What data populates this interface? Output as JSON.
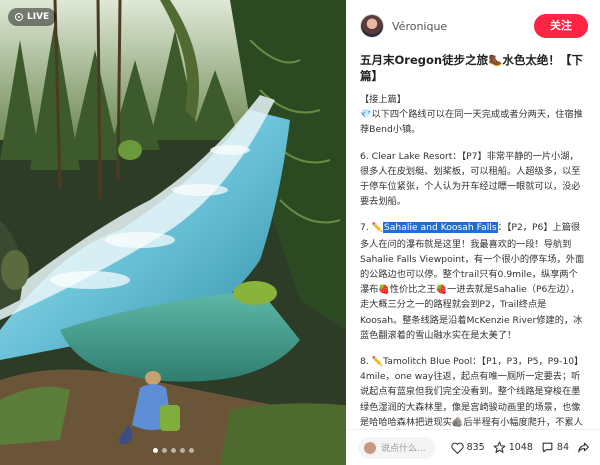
{
  "photo": {
    "live_label": "LIVE",
    "dot_count": 5,
    "active_dot": 1
  },
  "header": {
    "author": "Véronique",
    "follow_label": "关注"
  },
  "post": {
    "title": "五月末Oregon徒步之旅🥾水色太绝！【下篇】",
    "link_line_1": "【接上篇】",
    "link_line_2": "💎以下四个路线可以在同一天完成或者分两天，住宿推荐Bend小镇。",
    "p6": "6. Clear Lake Resort：【P7】非常平静的一片小湖，很多人在皮划艇、划桨板，可以租船。人超级多，以至于停车位紧张，个人认为开车经过瞟一眼就可以，没必要去划船。",
    "p7_prefix": "7. ",
    "p7_icon": "✏️",
    "p7_highlight": "Sahalie and Koosah Falls",
    "p7_rest": "：【P2，P6】上篇很多人在问的瀑布就是这里！我最喜欢的一段！导航到Sahalie Falls Viewpoint，有一个很小的停车场，外面的公路边也可以停。整个trail只有0.9mile，纵享两个瀑布🍓性价比之王🍓一进去就是Sahalie（P6左边），走大概三分之一的路程就会到P2，Trail终点是Koosah。整条线路是沿着McKenzie River修建的，冰蓝色翻滚着的雪山融水实在是太美了！",
    "p8": "8. ✏️Tamolitch Blue Pool：【P1，P3，P5，P9-10】4mile，one way往返，起点有唯一厕所一定要去；听说起点有蓝泉但我们完全没看到。整个线路是穿梭在墨绿色湿润的大森林里，像是宫崎骏动画里的场景，也像是哈哈哈森林把进现实🪨后半程有小幅度爬升，不累人的（尤其是对比了Smith Rock）。Blue Pool在路线终点，真的是好璀璨的一汪池水🌊这里是可以下水游泳或"
  },
  "footer": {
    "comment_placeholder": "说点什么...",
    "likes": "835",
    "stars": "1048",
    "comments": "84"
  }
}
